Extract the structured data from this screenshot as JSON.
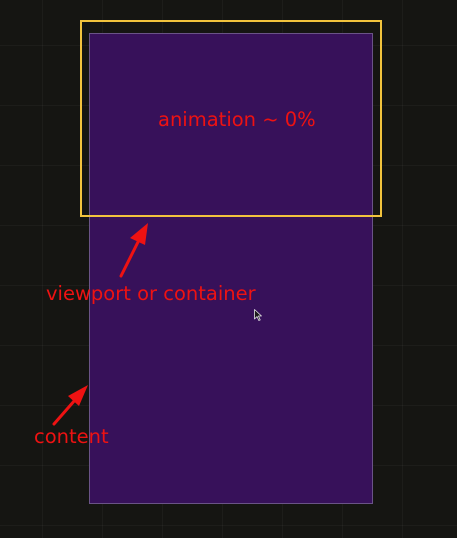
{
  "labels": {
    "animation": "animation ~ 0%",
    "viewport": "viewport or container",
    "content": "content"
  },
  "colors": {
    "background": "#151512",
    "content_fill": "#37115a",
    "content_border": "#6a5387",
    "viewport_border": "#f2c33d",
    "annotation": "#ee1212"
  },
  "icons": {
    "pointer": "mouse-pointer-icon"
  }
}
